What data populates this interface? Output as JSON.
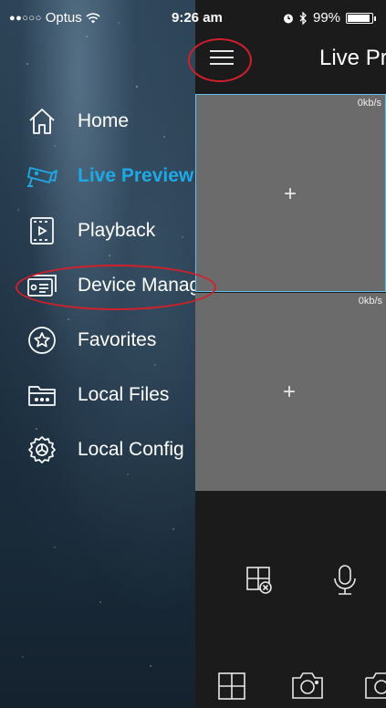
{
  "status_bar": {
    "signal": "●●○○○",
    "carrier": "Optus",
    "time": "9:26 am",
    "battery": "99%",
    "battery_level": 0.99
  },
  "sidebar": {
    "items": [
      {
        "label": "Home",
        "icon": "home-icon"
      },
      {
        "label": "Live Preview",
        "icon": "camera-icon",
        "active": true
      },
      {
        "label": "Playback",
        "icon": "playback-icon"
      },
      {
        "label": "Device Manager",
        "icon": "device-icon"
      },
      {
        "label": "Favorites",
        "icon": "star-icon"
      },
      {
        "label": "Local Files",
        "icon": "folder-icon"
      },
      {
        "label": "Local Config",
        "icon": "gear-icon"
      }
    ]
  },
  "main": {
    "title": "Live Preview",
    "tiles": [
      {
        "bitrate": "0kb/s",
        "add": "+"
      },
      {
        "bitrate": "0kb/s",
        "add": "+"
      }
    ]
  },
  "colors": {
    "accent": "#1fa8e6",
    "tile": "#6b6b6b",
    "annotation": "#d2202b"
  }
}
